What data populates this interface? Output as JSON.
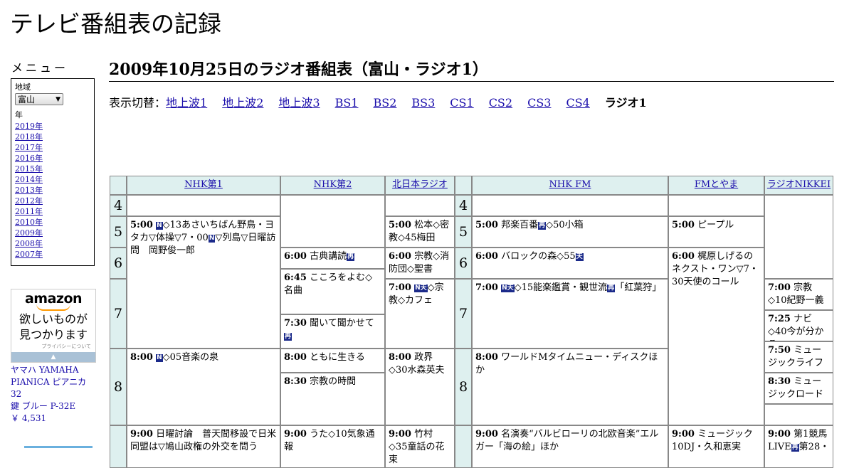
{
  "site_title": "テレビ番組表の記録",
  "menu": {
    "heading": "メニュー",
    "region_label": "地域",
    "region_value": "富山",
    "year_label": "年",
    "years": [
      "2019年",
      "2018年",
      "2017年",
      "2016年",
      "2015年",
      "2014年",
      "2013年",
      "2012年",
      "2011年",
      "2010年",
      "2009年",
      "2008年",
      "2007年"
    ]
  },
  "ad": {
    "logo": "amazon",
    "tagline1": "欲しいものが",
    "tagline2": "見つかります",
    "privacy": "プライバシーについて",
    "product_name1": "ヤマハ YAMAHA",
    "product_name2": "PIANICA ピアニカ 32",
    "product_name3": "鍵 ブルー P-32E",
    "product_price": "￥ 4,531"
  },
  "page_title": "2009年10月25日のラジオ番組表（富山・ラジオ1）",
  "switcher": {
    "label": "表示切替：",
    "links": [
      "地上波1",
      "地上波2",
      "地上波3",
      "BS1",
      "BS2",
      "BS3",
      "CS1",
      "CS2",
      "CS3",
      "CS4"
    ],
    "current": "ラジオ1"
  },
  "channels": [
    "NHK第1",
    "NHK第2",
    "北日本ラジオ",
    "NHK FM",
    "FMとやま",
    "ラジオNIKKEI"
  ],
  "hours": [
    "4",
    "5",
    "6",
    "7",
    "8"
  ],
  "badges": {
    "news": "N",
    "weather": "天",
    "stereo": "再"
  },
  "programs": {
    "nhk1": [
      {
        "time": "5:00",
        "badge": "N",
        "title": "◇13あさいちばん野鳥・ヨタカ▽体操▽7・00",
        "badge2": "N",
        "title2": "▽列島▽日曜訪問　岡野俊一郎"
      },
      {
        "time": "8:00",
        "badge": "N",
        "title": "◇05音楽の泉"
      },
      {
        "time": "9:00",
        "title": "日曜討論　普天間移設で日米同盟は▽鳩山政権の外交を問う"
      }
    ],
    "nhk2": [
      {
        "time": "6:00",
        "title": "古典講読",
        "badge": "再"
      },
      {
        "time": "6:45",
        "title": "こころをよむ◇名曲"
      },
      {
        "time": "7:30",
        "title": "聞いて聞かせて",
        "badge": "再"
      },
      {
        "time": "8:00",
        "title": "ともに生きる"
      },
      {
        "time": "8:30",
        "title": "宗教の時間"
      },
      {
        "time": "9:00",
        "title": "うた◇10気象通報"
      }
    ],
    "kitanihon": [
      {
        "time": "5:00",
        "title": "松本◇密教◇45梅田"
      },
      {
        "time": "6:00",
        "title": "宗教◇消防団◇聖書"
      },
      {
        "time": "7:00",
        "badge": "N天",
        "title": "◇宗教◇カフェ"
      },
      {
        "time": "8:00",
        "title": "政界◇30水森英夫"
      },
      {
        "time": "9:00",
        "title": "竹村◇35童話の花束"
      }
    ],
    "nhkfm": [
      {
        "time": "5:00",
        "title": "邦楽百番",
        "badge": "再",
        "title2": "◇50小箱"
      },
      {
        "time": "6:00",
        "title": "バロックの森◇55",
        "badge": "天"
      },
      {
        "time": "7:00",
        "badge": "N天",
        "title": "◇15能楽鑑賞・観世流",
        "badge2": "再",
        "title2": "「紅葉狩」"
      },
      {
        "time": "8:00",
        "title": "ワールドMタイムニュー・ディスクほか"
      },
      {
        "time": "9:00",
        "title": "名演奏“バルビローリの北欧音楽”エルガー「海の絵」ほか"
      }
    ],
    "fmtoyama": [
      {
        "time": "5:00",
        "title": "ピープル"
      },
      {
        "time": "6:00",
        "title": "梶原しげるのネクスト・ワン▽7・30天使のコール"
      },
      {
        "time": "9:00",
        "title": "ミュージック10DJ・久和恵実"
      }
    ],
    "nikkei": [
      {
        "time": "7:00",
        "title": "宗教◇10紀野一義",
        "badge": "再"
      },
      {
        "time": "7:25",
        "title": "ナビ◇40今が分かる"
      },
      {
        "time": "7:50",
        "title": "ミュージックライフ"
      },
      {
        "time": "8:30",
        "title": "ミュージックロード"
      },
      {
        "time": "9:00",
        "title": "第1競馬LIVE",
        "badge": "再",
        "title2": "第28・"
      }
    ]
  }
}
